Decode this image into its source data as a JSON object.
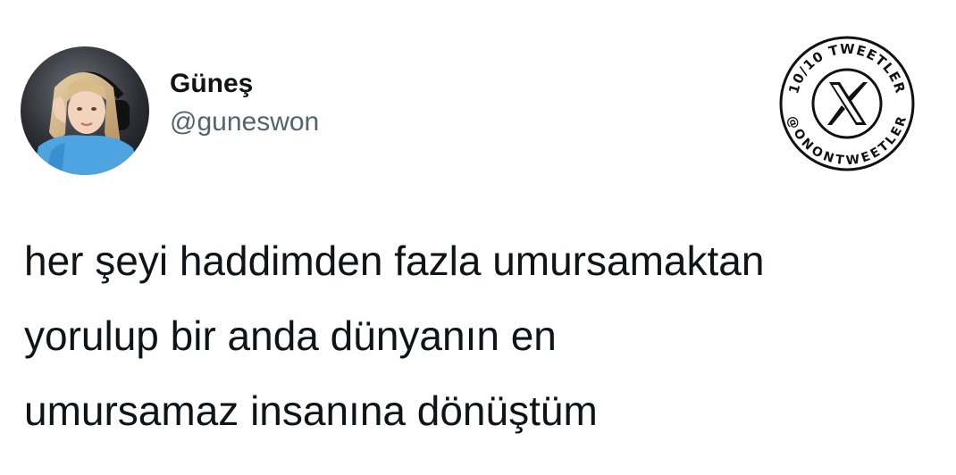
{
  "author": {
    "display_name": "Güneş",
    "handle": "@guneswon",
    "avatar_icon": "profile-photo"
  },
  "badge": {
    "top_text": "10/10 TWEETLER",
    "bottom_text": "@ONONTWEETLER",
    "center_icon": "x-logo-icon"
  },
  "tweet": {
    "lines": [
      "her şeyi haddimden fazla umursamaktan",
      "yorulup bir anda dünyanın en",
      "umursamaz insanına dönüştüm"
    ]
  },
  "colors": {
    "text": "#0f1419",
    "secondary_text": "#536471",
    "background": "#ffffff",
    "badge": "#111111"
  }
}
